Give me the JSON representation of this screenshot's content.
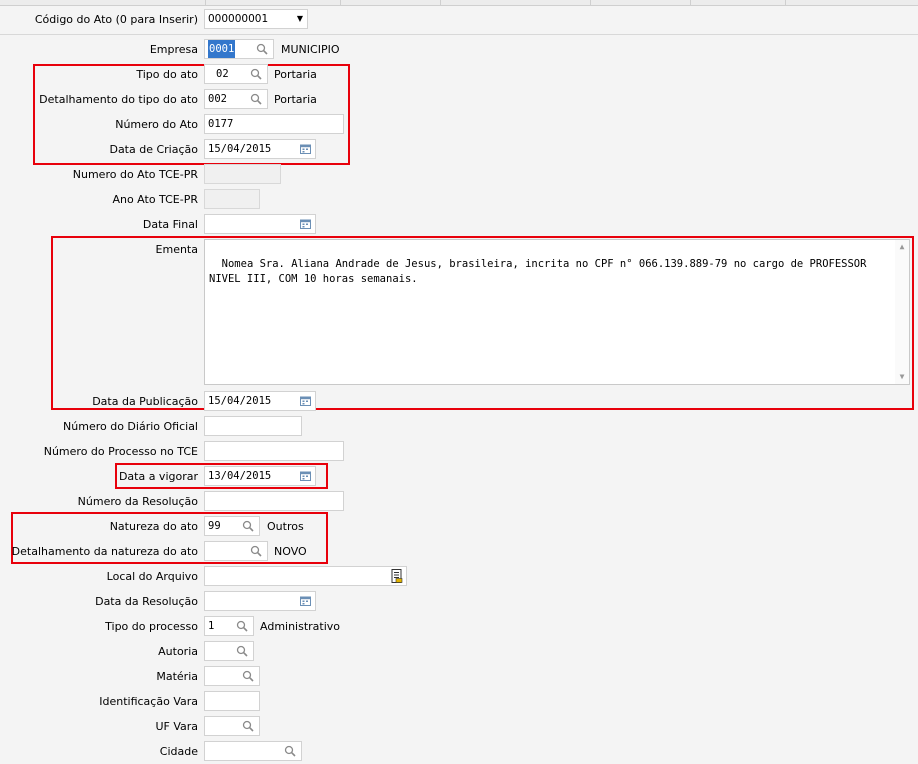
{
  "header": {
    "codigo_label": "Código do Ato (0 para Inserir)",
    "codigo_value": "000000001"
  },
  "form": {
    "empresa": {
      "label": "Empresa",
      "code": "0001",
      "desc": "MUNICIPIO"
    },
    "tipo_ato": {
      "label": "Tipo do ato",
      "code": "02",
      "desc": "Portaria"
    },
    "detalhamento_tipo": {
      "label": "Detalhamento do tipo do ato",
      "code": "002",
      "desc": "Portaria"
    },
    "numero_ato": {
      "label": "Número do Ato",
      "value": "0177"
    },
    "data_criacao": {
      "label": "Data de Criação",
      "value": "15/04/2015"
    },
    "numero_tce": {
      "label": "Numero do Ato TCE-PR",
      "value": ""
    },
    "ano_tce": {
      "label": "Ano Ato TCE-PR",
      "value": ""
    },
    "data_final": {
      "label": "Data Final",
      "value": ""
    },
    "ementa": {
      "label": "Ementa",
      "value": "Nomea Sra. Aliana Andrade de Jesus, brasileira, incrita no CPF n° 066.139.889-79 no cargo de PROFESSOR NIVEL III, COM 10 horas semanais."
    },
    "data_publicacao": {
      "label": "Data da Publicação",
      "value": "15/04/2015"
    },
    "numero_diario": {
      "label": "Número do Diário Oficial",
      "value": ""
    },
    "numero_processo_tce": {
      "label": "Número do Processo no TCE",
      "value": ""
    },
    "data_vigorar": {
      "label": "Data a vigorar",
      "value": "13/04/2015"
    },
    "numero_resolucao": {
      "label": "Número da Resolução",
      "value": ""
    },
    "natureza_ato": {
      "label": "Natureza do ato",
      "code": "99",
      "desc": "Outros"
    },
    "detalhamento_natureza": {
      "label": "Detalhamento da natureza do ato",
      "code": "",
      "desc": "NOVO"
    },
    "local_arquivo": {
      "label": "Local do Arquivo",
      "value": ""
    },
    "data_resolucao": {
      "label": "Data da Resolução",
      "value": ""
    },
    "tipo_processo": {
      "label": "Tipo do processo",
      "code": "1",
      "desc": "Administrativo"
    },
    "autoria": {
      "label": "Autoria",
      "value": ""
    },
    "materia": {
      "label": "Matéria",
      "value": ""
    },
    "identificacao_vara": {
      "label": "Identificação Vara",
      "value": ""
    },
    "uf_vara": {
      "label": "UF Vara",
      "value": ""
    },
    "cidade": {
      "label": "Cidade",
      "value": ""
    }
  },
  "icons": {
    "lookup": "magnifier-icon",
    "calendar": "calendar-icon",
    "folder": "file-browse-icon",
    "dropdown": "dropdown-arrow-icon"
  },
  "colors": {
    "highlight_box": "#e8000b",
    "selection": "#3377cc"
  }
}
